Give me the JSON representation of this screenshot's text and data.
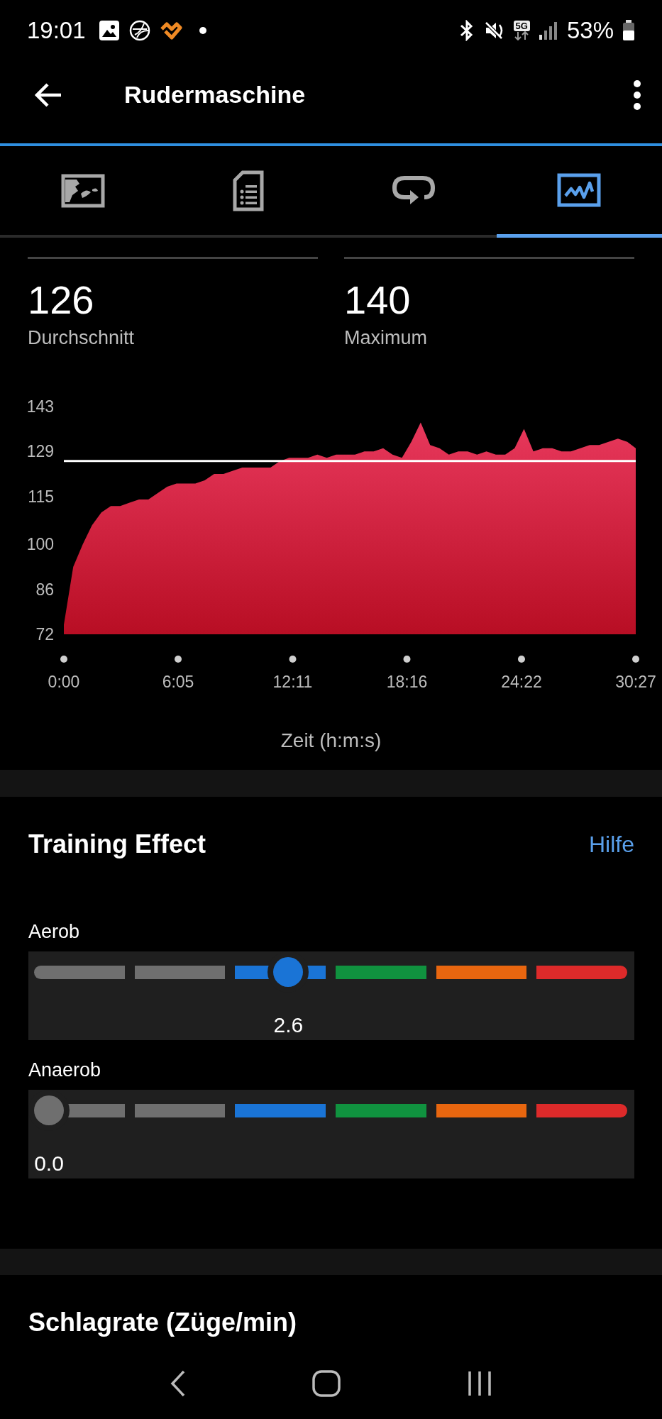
{
  "status_bar": {
    "time": "19:01",
    "network": "5G",
    "battery": "53%"
  },
  "header": {
    "title": "Rudermaschine"
  },
  "tabs": [
    {
      "kind": "map",
      "selected": false
    },
    {
      "kind": "document",
      "selected": false
    },
    {
      "kind": "loop",
      "selected": false
    },
    {
      "kind": "graph",
      "selected": true
    }
  ],
  "stats": [
    {
      "value": "126",
      "label": "Durchschnitt"
    },
    {
      "value": "140",
      "label": "Maximum"
    }
  ],
  "chart": {
    "chart_data": {
      "type": "area",
      "xlabel": "Zeit (h:m:s)",
      "x": [
        0,
        30,
        60,
        90,
        120,
        150,
        180,
        210,
        240,
        270,
        300,
        330,
        360,
        390,
        420,
        450,
        480,
        510,
        540,
        570,
        600,
        630,
        660,
        690,
        720,
        750,
        780,
        810,
        840,
        870,
        900,
        930,
        960,
        990,
        1020,
        1050,
        1080,
        1110,
        1140,
        1170,
        1200,
        1230,
        1260,
        1290,
        1320,
        1350,
        1380,
        1410,
        1440,
        1470,
        1500,
        1530,
        1560,
        1590,
        1620,
        1650,
        1680,
        1710,
        1740,
        1770,
        1800,
        1827
      ],
      "series": [
        {
          "color": "#e8385c",
          "values": [
            75,
            93,
            100,
            106,
            110,
            112,
            112,
            113,
            114,
            114,
            116,
            118,
            119,
            119,
            119,
            120,
            122,
            122,
            123,
            124,
            124,
            124,
            124,
            126,
            127,
            127,
            127,
            128,
            127,
            128,
            128,
            128,
            129,
            129,
            130,
            128,
            127,
            132,
            138,
            131,
            130,
            128,
            129,
            129,
            128,
            129,
            128,
            128,
            130,
            136,
            129,
            130,
            130,
            129,
            129,
            130,
            131,
            131,
            132,
            133,
            132,
            130
          ]
        }
      ],
      "xlim": [
        0,
        1827
      ],
      "ylim": [
        72,
        143
      ],
      "xticks": [
        {
          "value": 0,
          "label": "0:00"
        },
        {
          "value": 365,
          "label": "6:05"
        },
        {
          "value": 731,
          "label": "12:11"
        },
        {
          "value": 1096,
          "label": "18:16"
        },
        {
          "value": 1462,
          "label": "24:22"
        },
        {
          "value": 1827,
          "label": "30:27"
        }
      ],
      "yticks": [
        72,
        86,
        100,
        115,
        129,
        143
      ],
      "ref_lines": [
        {
          "axis": "y",
          "value": 126
        }
      ]
    }
  },
  "training_effect": {
    "title": "Training Effect",
    "help_link": "Hilfe",
    "meters": [
      {
        "label": "Aerob",
        "level": 0.425,
        "reading": "2.6"
      },
      {
        "label": "Anaerob",
        "level": 0,
        "reading": "0.0"
      }
    ]
  },
  "next_section": {
    "title": "Schlagrate (Züge/min)"
  }
}
